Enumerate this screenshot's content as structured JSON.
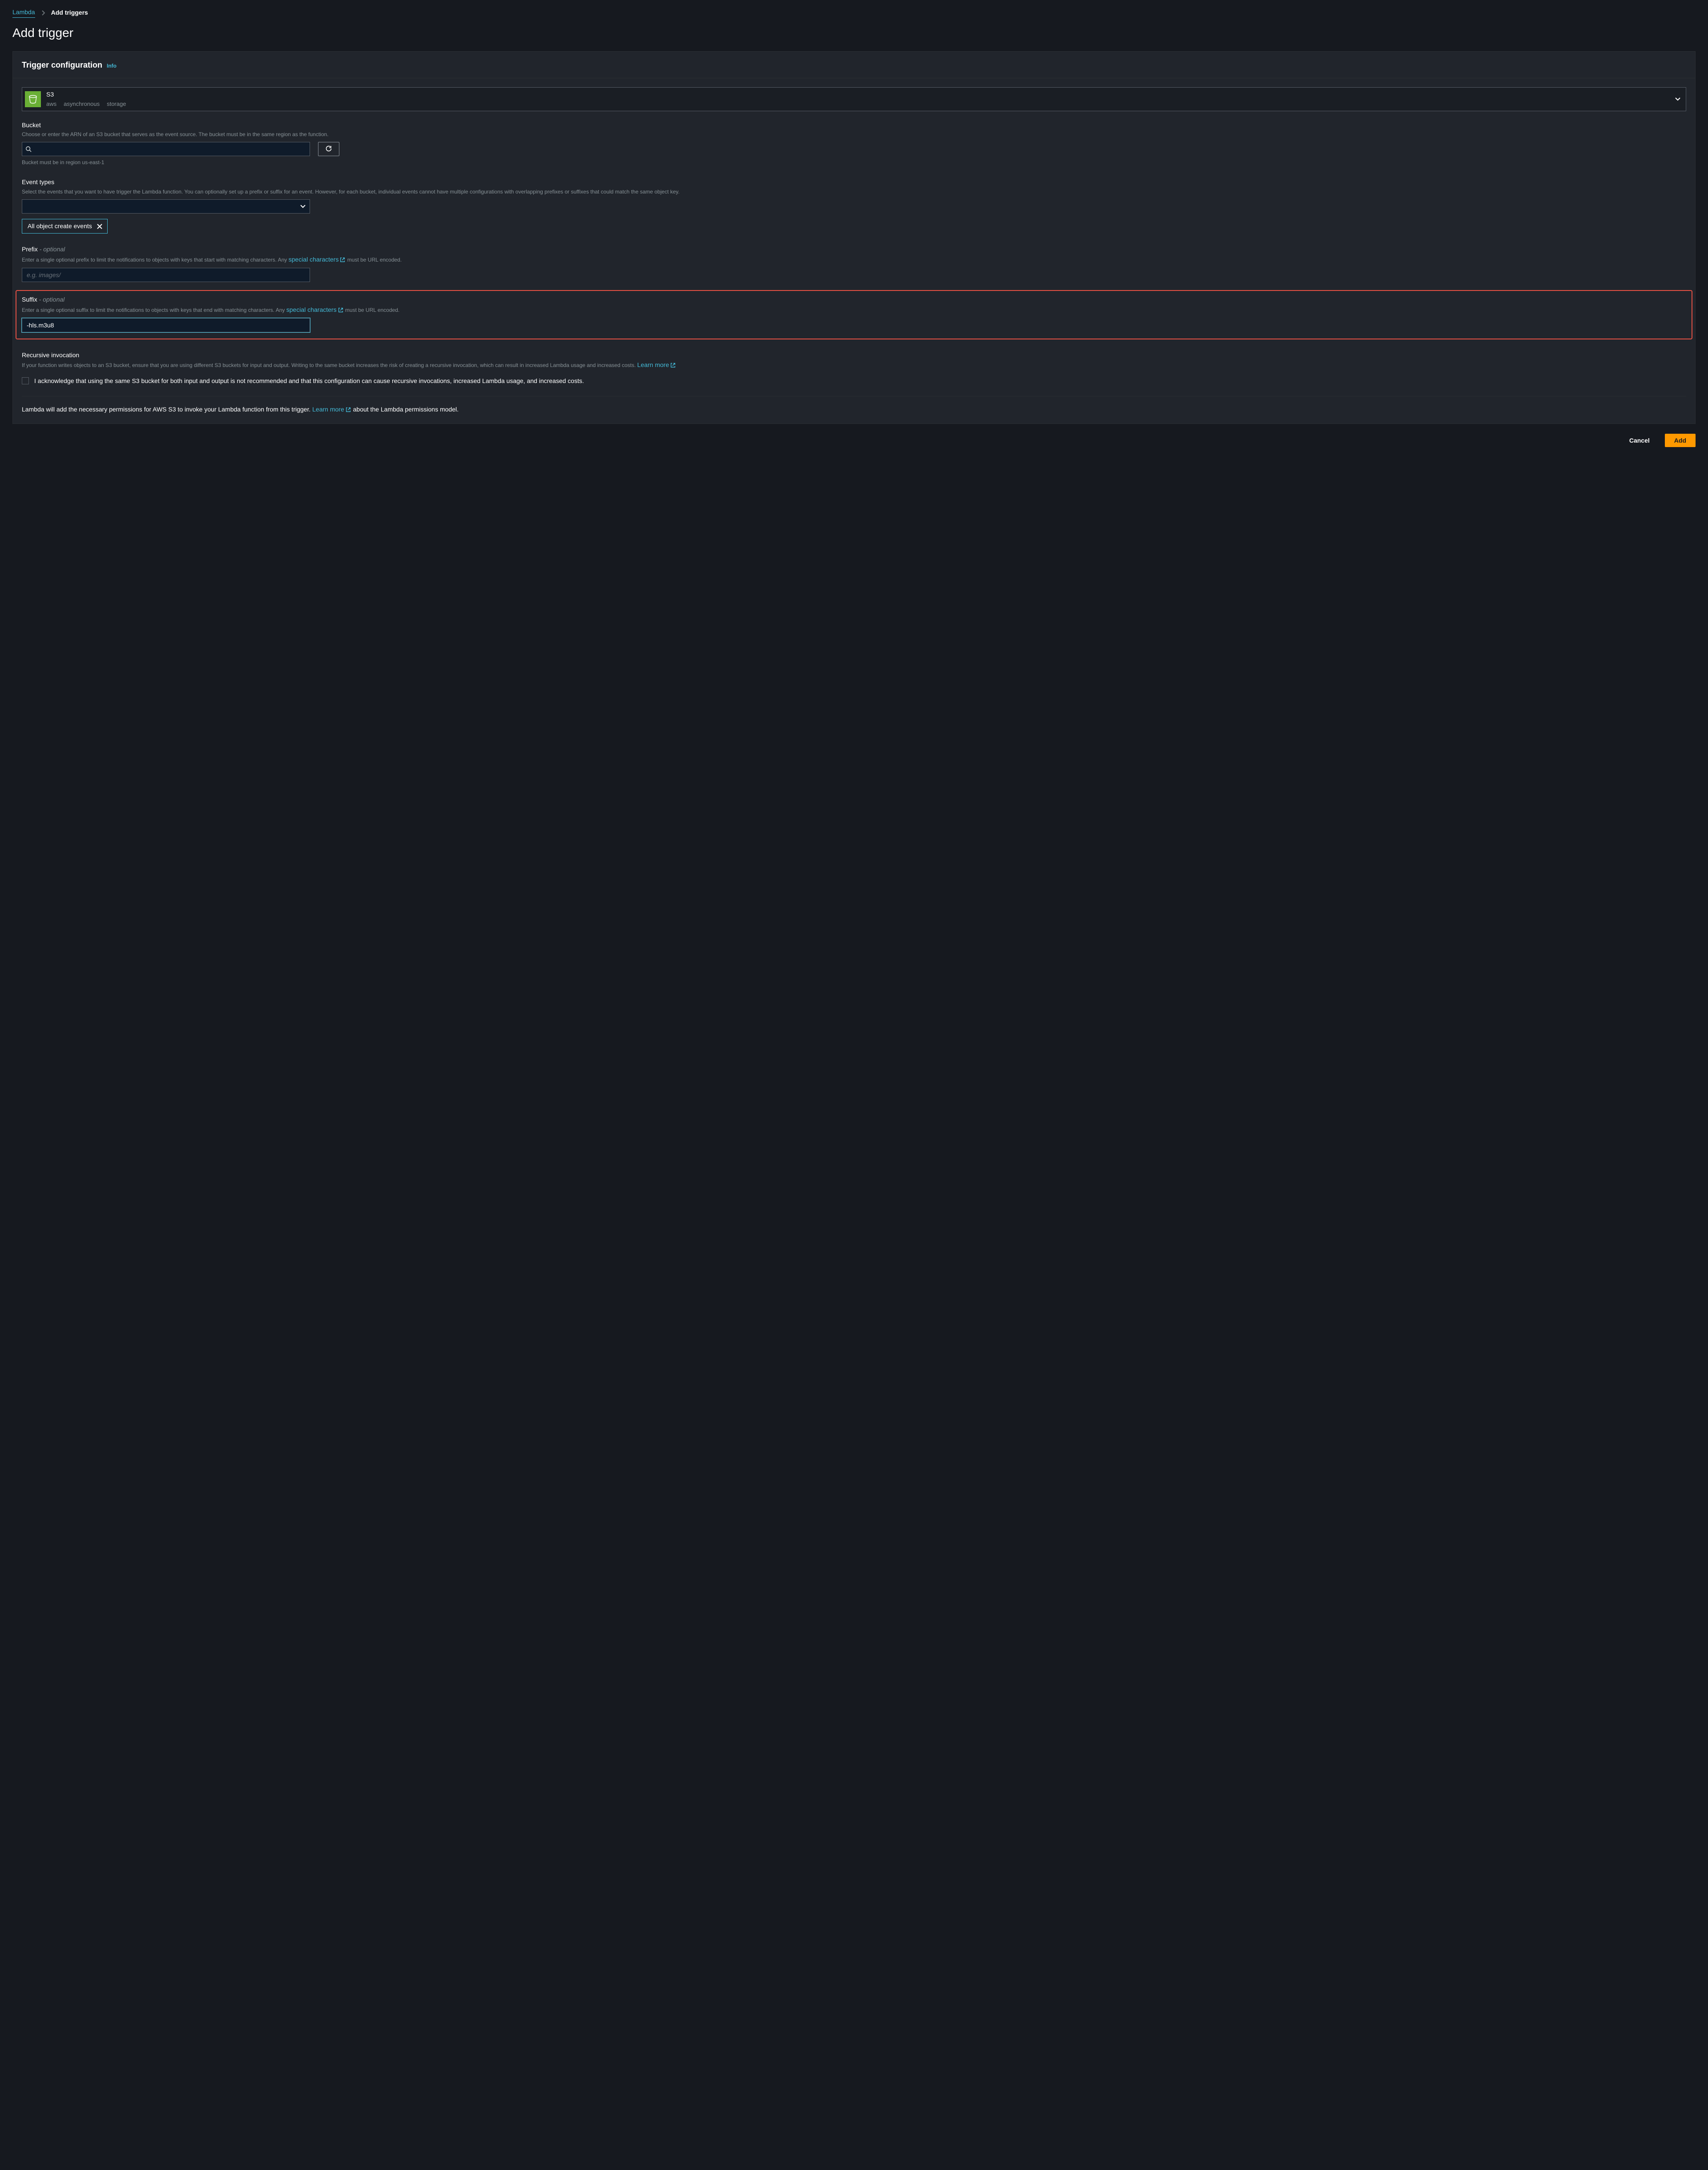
{
  "breadcrumb": {
    "root": "Lambda",
    "current": "Add triggers"
  },
  "page_title": "Add trigger",
  "panel": {
    "title": "Trigger configuration",
    "info": "Info"
  },
  "source": {
    "name": "S3",
    "tags": [
      "aws",
      "asynchronous",
      "storage"
    ]
  },
  "bucket": {
    "label": "Bucket",
    "description": "Choose or enter the ARN of an S3 bucket that serves as the event source. The bucket must be in the same region as the function.",
    "value": "",
    "hint": "Bucket must be in region us-east-1"
  },
  "event_types": {
    "label": "Event types",
    "description": "Select the events that you want to have trigger the Lambda function. You can optionally set up a prefix or suffix for an event. However, for each bucket, individual events cannot have multiple configurations with overlapping prefixes or suffixes that could match the same object key.",
    "selected_chip": "All object create events"
  },
  "prefix": {
    "label": "Prefix",
    "optional": "- optional",
    "desc_before": "Enter a single optional prefix to limit the notifications to objects with keys that start with matching characters. Any ",
    "link": "special characters",
    "desc_after": " must be URL encoded.",
    "placeholder": "e.g. images/",
    "value": ""
  },
  "suffix": {
    "label": "Suffix",
    "optional": "- optional",
    "desc_before": "Enter a single optional suffix to limit the notifications to objects with keys that end with matching characters. Any ",
    "link": "special characters",
    "desc_after": " must be URL encoded.",
    "value": "-hls.m3u8"
  },
  "recursive": {
    "label": "Recursive invocation",
    "desc_before": "If your function writes objects to an S3 bucket, ensure that you are using different S3 buckets for input and output. Writing to the same bucket increases the risk of creating a recursive invocation, which can result in increased Lambda usage and increased costs. ",
    "link": "Learn more",
    "checkbox_label": "I acknowledge that using the same S3 bucket for both input and output is not recommended and that this configuration can cause recursive invocations, increased Lambda usage, and increased costs."
  },
  "permissions_note": {
    "before": "Lambda will add the necessary permissions for AWS S3 to invoke your Lambda function from this trigger. ",
    "link": "Learn more",
    "after": " about the Lambda permissions model."
  },
  "buttons": {
    "cancel": "Cancel",
    "add": "Add"
  }
}
